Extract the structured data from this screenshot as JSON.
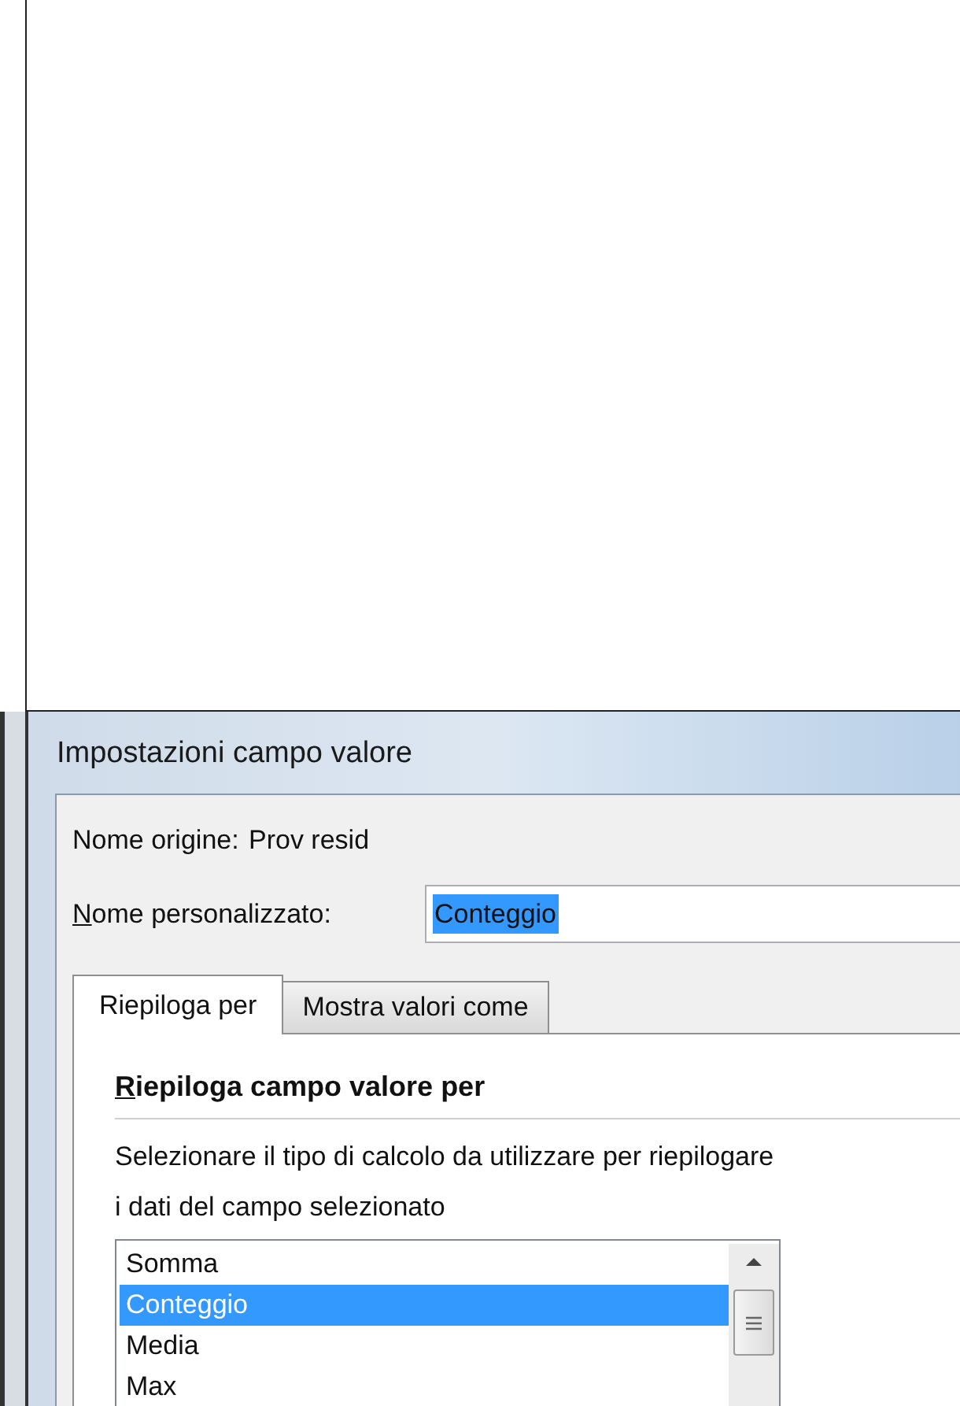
{
  "dialog": {
    "title": "Impostazioni campo valore",
    "source_name": {
      "label": "Nome origine:",
      "value": "Prov resid"
    },
    "custom_name": {
      "label": "Nome personalizzato:",
      "underline_first": true,
      "value": "Conteggio",
      "highlighted": true
    },
    "tabs": [
      {
        "label": "Riepiloga per",
        "selected": true
      },
      {
        "label": "Mostra valori come",
        "selected": false
      }
    ],
    "section": {
      "heading": "Riepiloga campo valore per",
      "underline_first": true,
      "description": [
        "Selezionare il tipo di calcolo da utilizzare per riepilogare",
        "i dati del campo selezionato"
      ],
      "list": [
        {
          "label": "Somma",
          "selected": false
        },
        {
          "label": "Conteggio",
          "selected": true
        },
        {
          "label": "Media",
          "selected": false
        },
        {
          "label": "Max",
          "selected": false
        }
      ]
    }
  }
}
